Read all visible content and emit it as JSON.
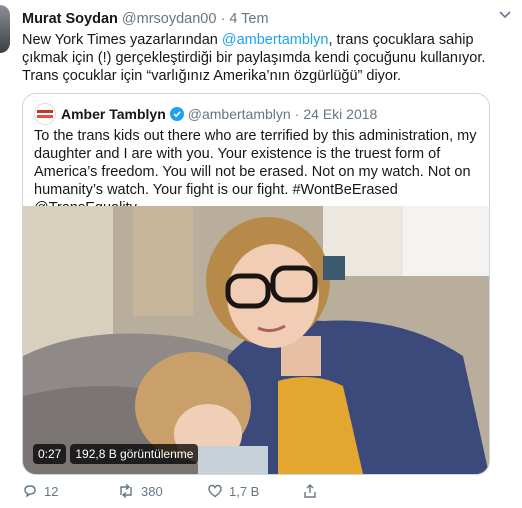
{
  "tweet": {
    "author_name": "Murat Soydan",
    "handle": "@mrsoydan00",
    "separator": "·",
    "time": "4 Tem",
    "text_before": "New York Times yazarlarından ",
    "mention": "@ambertamblyn",
    "text_after": ", trans çocuklara sahip çıkmak için (!) gerçekleştirdiği bir paylaşımda kendi çocuğunu kullanıyor. Trans çocuklar için “varlığınız Amerika’nın özgürlüğü” diyor."
  },
  "quote": {
    "author_name": "Amber Tamblyn",
    "handle": "@ambertamblyn",
    "separator": "·",
    "date": "24 Eki 2018",
    "text": "To the trans kids out there who are terrified by this administration, my daughter and I are with you. Your existence is the truest form of America’s freedom. You will not be erased. Not on my watch. Not on humanity’s watch. Your fight is our fight. #WontBeErased @TransEquality",
    "video_duration": "0:27",
    "video_views": "192,8 B görüntülenme"
  },
  "actions": {
    "reply_count": "12",
    "retweet_count": "380",
    "like_count": "1,7 B"
  },
  "icons": {
    "caret": "chevron-down-icon",
    "verified": "verified-badge-icon",
    "reply": "reply-icon",
    "retweet": "retweet-icon",
    "like": "heart-icon",
    "share": "share-icon"
  },
  "colors": {
    "accent": "#1da1f2",
    "muted": "#657786",
    "border": "#ccd6dd"
  }
}
